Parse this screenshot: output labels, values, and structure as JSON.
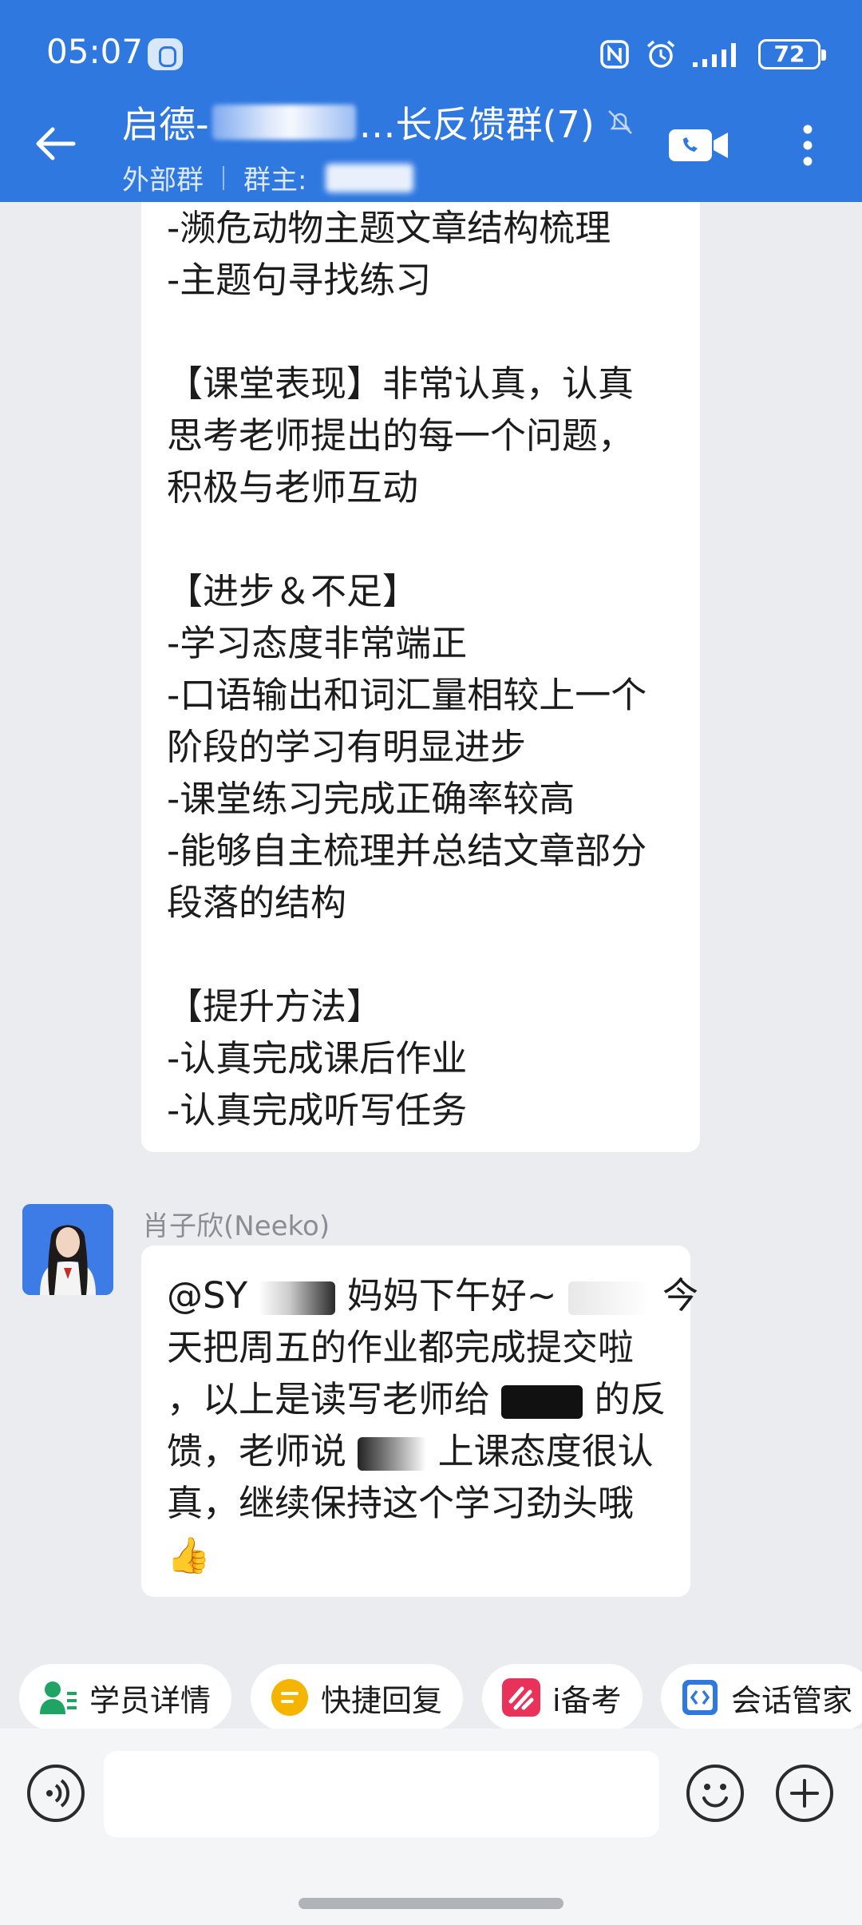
{
  "status_bar": {
    "time": "05:07",
    "battery": "72"
  },
  "header": {
    "title_prefix": "启德-",
    "title_suffix": "…长反馈群(7)",
    "subtitle_external": "外部群",
    "subtitle_owner": "群主:"
  },
  "messages": {
    "report_lines": [
      "-濒危动物主题文章结构梳理",
      "-主题句寻找练习",
      "",
      "【课堂表现】非常认真，认真",
      "思考老师提出的每一个问题，",
      "积极与老师互动",
      "",
      "【进步＆不足】",
      "-学习态度非常端正",
      "-口语输出和词汇量相较上一个",
      "阶段的学习有明显进步",
      "-课堂练习完成正确率较高",
      "-能够自主梳理并总结文章部分",
      "段落的结构",
      "",
      "【提升方法】",
      "-认真完成课后作业",
      "-认真完成听写任务"
    ],
    "sender_name": "肖子欣(Neeko)",
    "reply": {
      "l1a": "@SY",
      "l1b": "妈妈下午好~",
      "l1c": "今",
      "l2": "天把周五的作业都完成提交啦",
      "l3a": "，以上是读写老师给",
      "l3b": "的反",
      "l4a": "馈，老师说",
      "l4b": "上课态度很认",
      "l5": "真，继续保持这个学习劲头哦",
      "emoji": "👍"
    }
  },
  "quick_actions": [
    {
      "label": "学员详情",
      "icon": "student-detail-icon",
      "color": "#1fa463"
    },
    {
      "label": "快捷回复",
      "icon": "quick-reply-icon",
      "color": "#f5b400"
    },
    {
      "label": "i备考",
      "icon": "ibeikao-icon",
      "color": "#e8325a"
    },
    {
      "label": "会话管家",
      "icon": "session-manager-icon",
      "color": "#2f78e0"
    }
  ],
  "input": {
    "placeholder": ""
  },
  "colors": {
    "header_bg": "#2f78e0",
    "chat_bg": "#eaecf0"
  }
}
